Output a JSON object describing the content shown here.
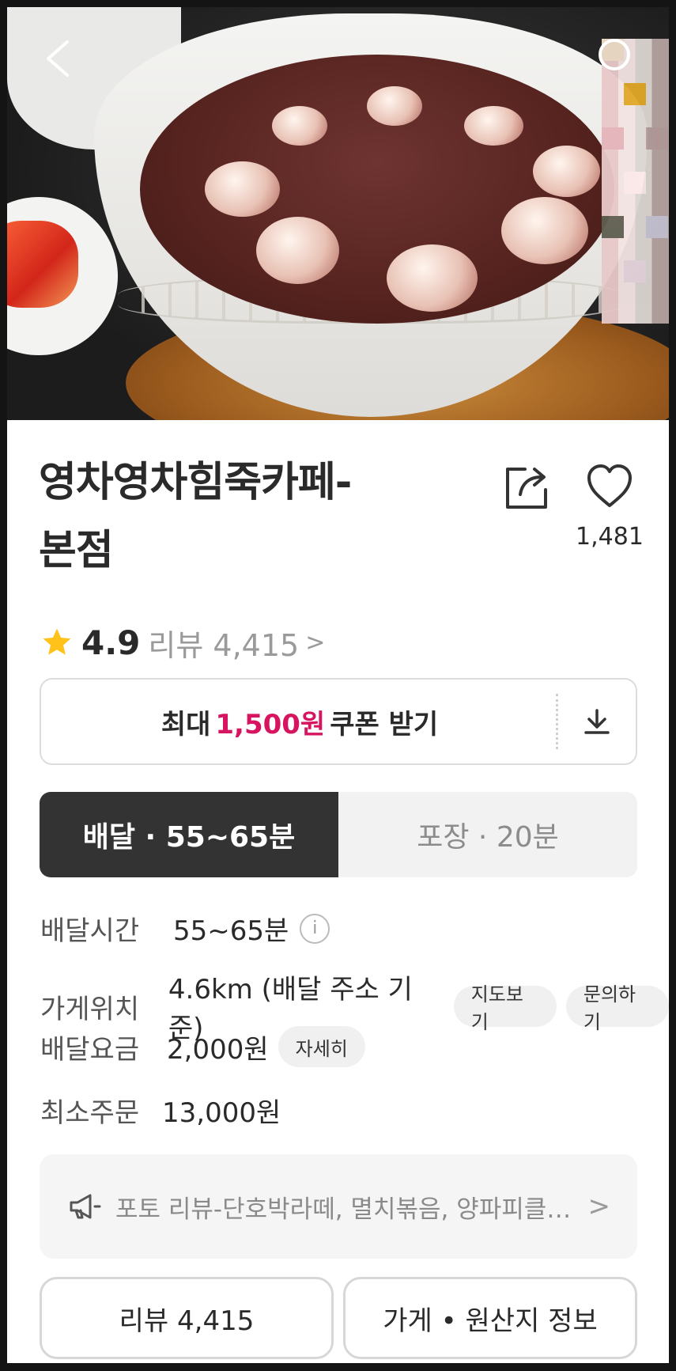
{
  "hero": {
    "alt": ""
  },
  "store": {
    "name_line1": "영차영차힘죽카페-",
    "name_line2": "본점",
    "like_count": "1,481",
    "rating": "4.9",
    "review_label": "리뷰 4,415",
    "review_chevron": ">"
  },
  "coupon": {
    "prefix": "최대",
    "amount": "1,500원",
    "suffix": "쿠폰 받기"
  },
  "tabs": [
    {
      "label": "배달 · 55~65분",
      "active": true
    },
    {
      "label": "포장 · 20분",
      "active": false
    }
  ],
  "info": {
    "delivery_time_label": "배달시간",
    "delivery_time_value": "55~65분",
    "info_glyph": "i",
    "location_label": "가게위치",
    "location_value": "4.6km (배달 주소 기준)",
    "map_button": "지도보기",
    "inquiry_button": "문의하기",
    "fee_label": "배달요금",
    "fee_value": "2,000원",
    "fee_detail_button": "자세히",
    "min_order_label": "최소주문",
    "min_order_value": "13,000원"
  },
  "notice": {
    "text": "포토 리뷰-단호박라떼, 멸치볶음, 양파피클 ...",
    "chevron": ">"
  },
  "bottom": {
    "reviews_button": "리뷰 4,415",
    "store_info_button": "가게 • 원산지 정보"
  },
  "colors": {
    "accent": "#d7145f",
    "star": "#ffc21a",
    "tab_active_bg": "#333333"
  },
  "icons": {
    "back": "back-chevron-icon",
    "search": "search-icon",
    "share": "share-icon",
    "like": "heart-icon",
    "star": "star-icon",
    "download": "download-icon",
    "info": "info-icon",
    "megaphone": "megaphone-icon",
    "chevron": "chevron-right-icon"
  }
}
